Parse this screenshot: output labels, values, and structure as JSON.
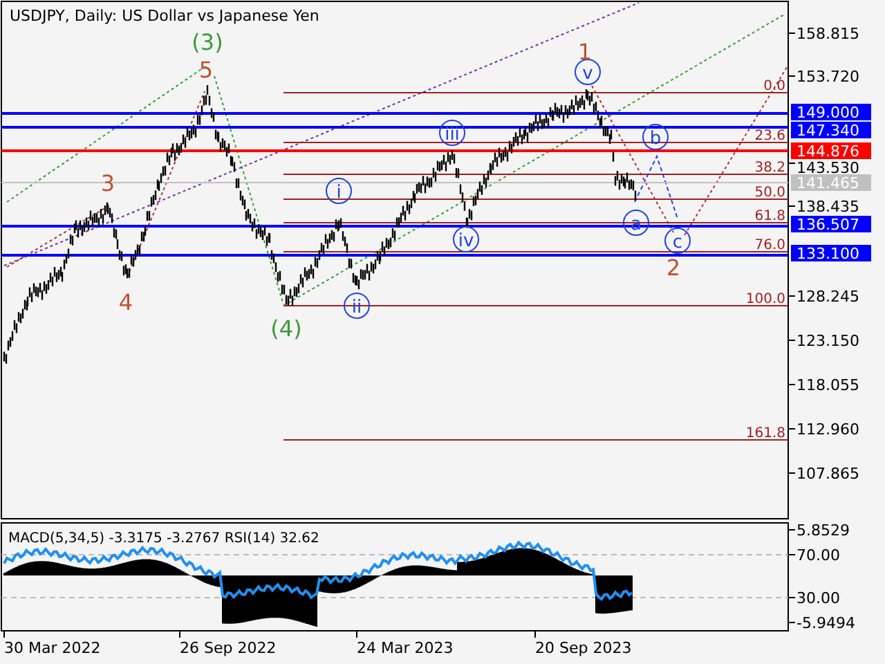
{
  "title": "USDJPY, Daily:  US Dollar vs Japanese Yen",
  "price_axis": {
    "ticks": [
      "158.815",
      "153.720",
      "143.530",
      "138.435",
      "128.245",
      "123.150",
      "118.055",
      "112.960",
      "107.865"
    ]
  },
  "price_markers": [
    {
      "label": "149.000",
      "color": "#0000ff"
    },
    {
      "label": "147.340",
      "color": "#0000ff"
    },
    {
      "label": "144.876",
      "color": "#ff0000"
    },
    {
      "label": "141.465",
      "color": "#c0c0c0"
    },
    {
      "label": "136.507",
      "color": "#0000ff"
    },
    {
      "label": "133.100",
      "color": "#0000ff"
    }
  ],
  "fib_levels": [
    "0.0",
    "23.6",
    "38.2",
    "50.0",
    "61.8",
    "76.0",
    "100.0",
    "161.8"
  ],
  "wave_labels": [
    {
      "label": "(3)",
      "kind": "plain",
      "color": "#3a9a3a"
    },
    {
      "label": "5",
      "kind": "plain",
      "color": "#c05030"
    },
    {
      "label": "3",
      "kind": "plain",
      "color": "#c05030"
    },
    {
      "label": "4",
      "kind": "plain",
      "color": "#c05030"
    },
    {
      "label": "(4)",
      "kind": "plain",
      "color": "#3a9a3a"
    },
    {
      "label": "i",
      "kind": "circled",
      "color": "#2040e0"
    },
    {
      "label": "ii",
      "kind": "circled",
      "color": "#2040e0"
    },
    {
      "label": "iii",
      "kind": "circled",
      "color": "#2040e0"
    },
    {
      "label": "iv",
      "kind": "circled",
      "color": "#2040e0"
    },
    {
      "label": "v",
      "kind": "circled",
      "color": "#2040e0"
    },
    {
      "label": "1",
      "kind": "plain",
      "color": "#c05030"
    },
    {
      "label": "a",
      "kind": "circled",
      "color": "#2040e0"
    },
    {
      "label": "b",
      "kind": "circled",
      "color": "#2040e0"
    },
    {
      "label": "c",
      "kind": "circled",
      "color": "#2040e0"
    },
    {
      "label": "2",
      "kind": "plain",
      "color": "#c05030"
    }
  ],
  "indicator": {
    "label": "MACD(5,34,5) -3.3175 -3.2767 RSI(14) 32.62",
    "ticks": [
      "5.8529",
      "70.00",
      "30.00",
      "-5.9494"
    ]
  },
  "time_axis": {
    "ticks": [
      "30 Mar 2022",
      "26 Sep 2022",
      "24 Mar 2023",
      "20 Sep 2023"
    ]
  }
}
